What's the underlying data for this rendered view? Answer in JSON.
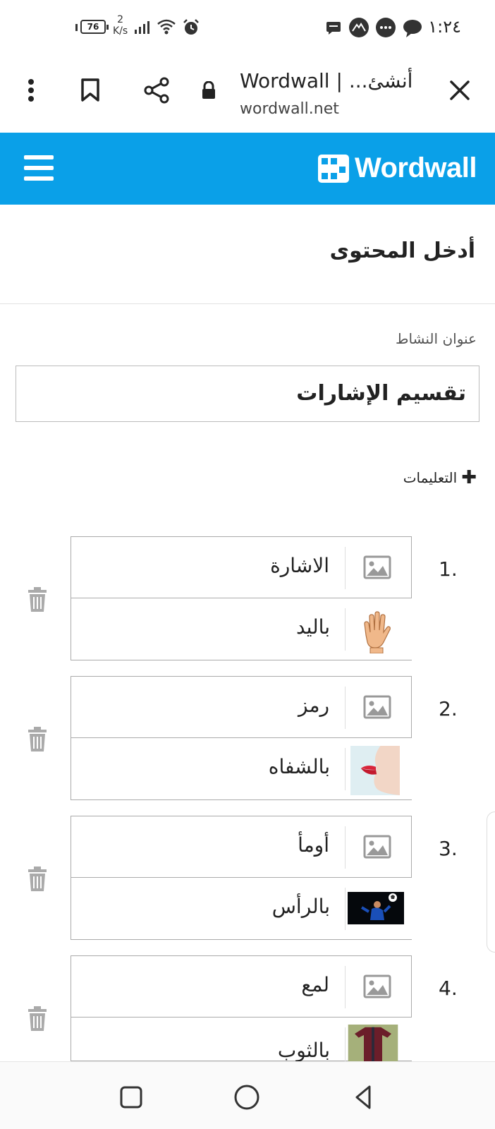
{
  "status_bar": {
    "battery": "76",
    "net_speed_value": "2",
    "net_speed_unit": "K/s",
    "time": "١:٢٤"
  },
  "browser": {
    "page_title": "Wordwall | ...أنشئ",
    "url": "wordwall.net"
  },
  "header": {
    "logo_text": "Wordwall",
    "brand_color": "#0aa0e8"
  },
  "editor": {
    "section_title": "أدخل المحتوى",
    "activity_title_label": "عنوان النشاط",
    "activity_title_value": "تقسيم الإشارات",
    "instructions_label": "التعليمات"
  },
  "items": [
    {
      "number": "1.",
      "term": "الاشارة",
      "definition": "باليد",
      "definition_image": "hand-image"
    },
    {
      "number": "2.",
      "term": "رمز",
      "definition": "بالشفاه",
      "definition_image": "lips-image"
    },
    {
      "number": "3.",
      "term": "أومأ",
      "definition": "بالرأس",
      "definition_image": "header-soccer-image"
    },
    {
      "number": "4.",
      "term": "لمع",
      "definition": "بالثوب",
      "definition_image": "garment-image"
    }
  ]
}
